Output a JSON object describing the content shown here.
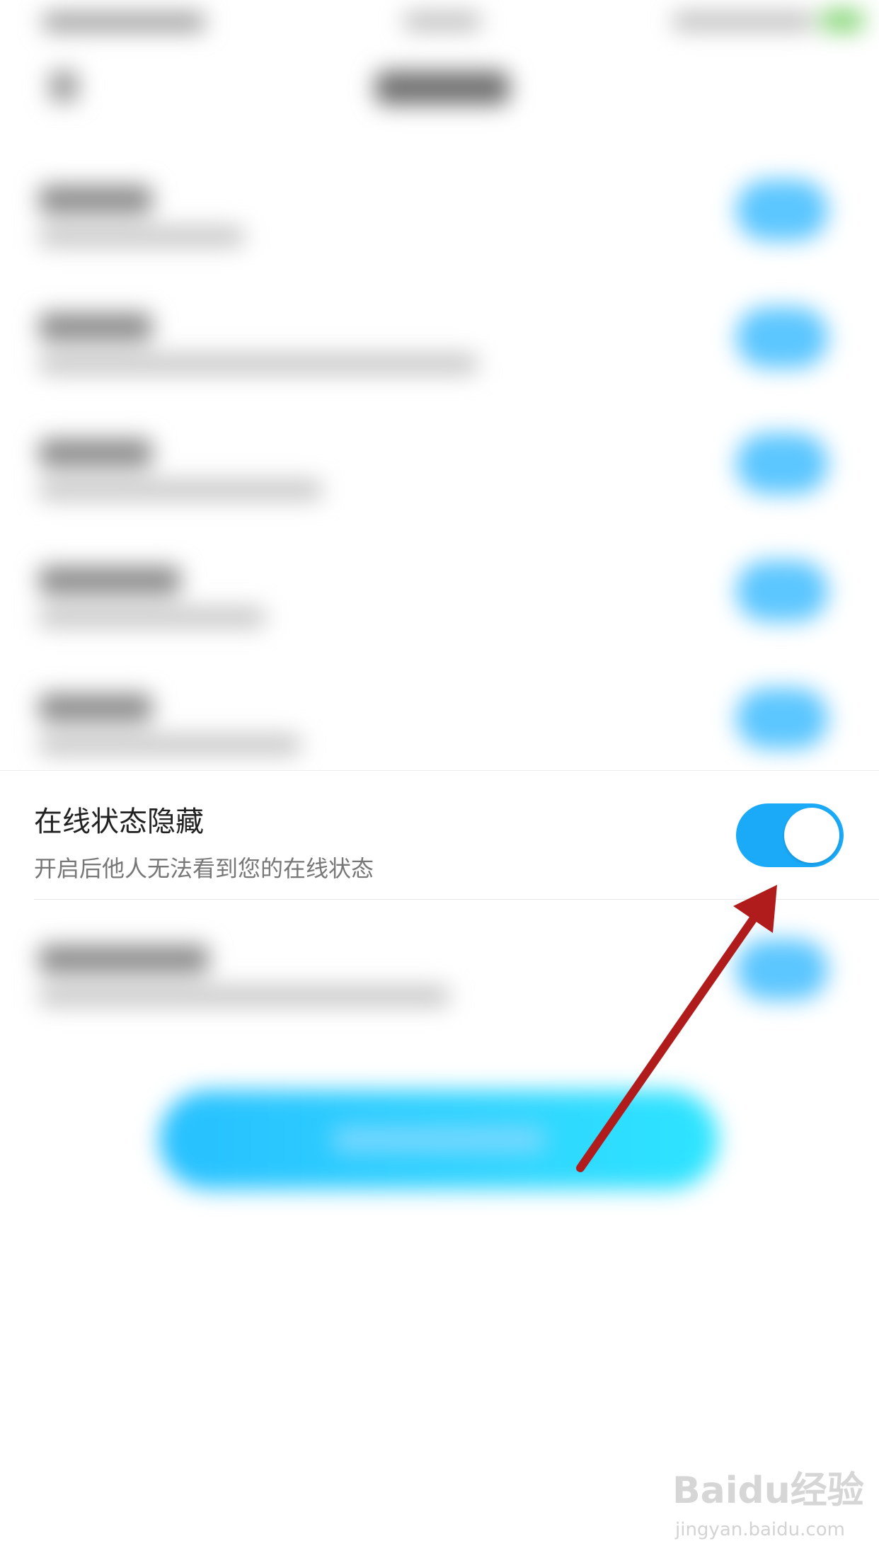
{
  "setting": {
    "title": "在线状态隐藏",
    "description": "开启后他人无法看到您的在线状态",
    "toggle_on": true
  },
  "colors": {
    "toggle_on": "#1aaaf8",
    "arrow": "#b01c1c",
    "button_gradient": "#27c0ff"
  },
  "watermark": {
    "logo": "Baidu经验",
    "url": "jingyan.baidu.com"
  }
}
